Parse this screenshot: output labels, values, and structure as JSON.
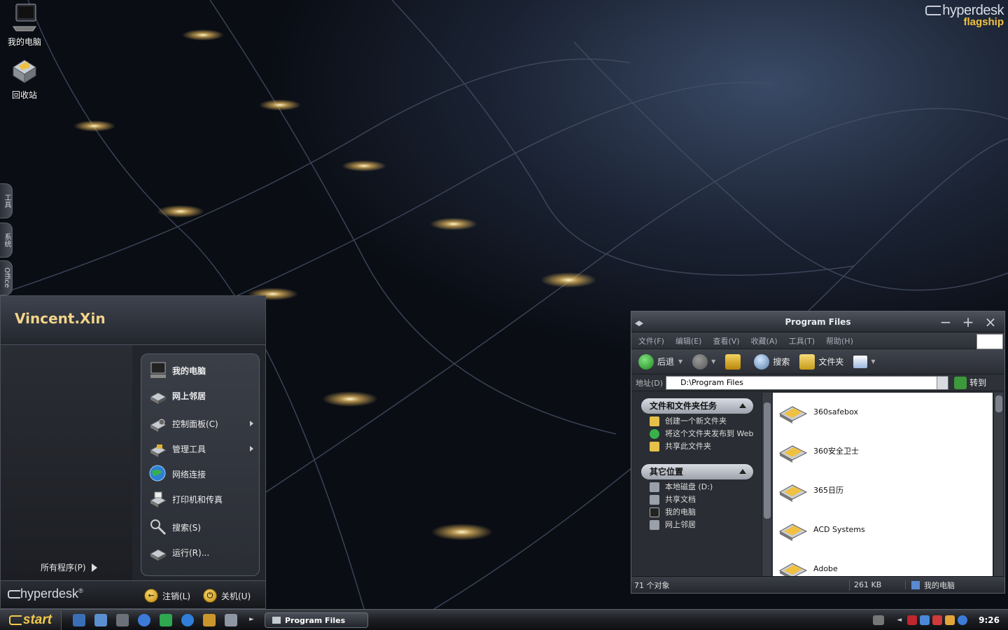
{
  "brand": {
    "name": "hyperdesk",
    "edition": "flagship"
  },
  "desktop_icons": [
    {
      "label": "我的电脑",
      "icon": "computer-icon"
    },
    {
      "label": "回收站",
      "icon": "recycle-bin-icon"
    }
  ],
  "side_tabs": [
    "工具",
    "系统",
    "Office"
  ],
  "start_menu": {
    "user": "Vincent.Xin",
    "all_programs": "所有程序(P)",
    "items": [
      {
        "label": "我的电脑",
        "icon": "computer-icon"
      },
      {
        "label": "网上邻居",
        "icon": "network-icon"
      },
      {
        "label": "控制面板(C)",
        "icon": "control-panel-icon"
      },
      {
        "label": "管理工具",
        "icon": "admin-tools-icon"
      },
      {
        "label": "网络连接",
        "icon": "network-connections-icon"
      },
      {
        "label": "打印机和传真",
        "icon": "printer-icon"
      },
      {
        "label": "搜索(S)",
        "icon": "search-icon"
      },
      {
        "label": "运行(R)...",
        "icon": "run-icon"
      }
    ],
    "footer": {
      "logo": "hyperdesk",
      "logoff": "注销(L)",
      "shutdown": "关机(U)"
    }
  },
  "taskbar": {
    "start": "start",
    "window_button": "Program Files",
    "clock": "9:26"
  },
  "explorer": {
    "title": "Program Files",
    "menu": [
      "文件(F)",
      "编辑(E)",
      "查看(V)",
      "收藏(A)",
      "工具(T)",
      "帮助(H)"
    ],
    "toolbar": {
      "back": "后退",
      "search": "搜索",
      "folders": "文件夹"
    },
    "address": {
      "label": "地址(D)",
      "value": "D:\\Program Files",
      "go": "转到"
    },
    "tasks": {
      "header": "文件和文件夹任务",
      "links": [
        "创建一个新文件夹",
        "将这个文件夹发布到 Web",
        "共享此文件夹"
      ]
    },
    "places": {
      "header": "其它位置",
      "links": [
        "本地磁盘 (D:)",
        "共享文档",
        "我的电脑",
        "网上邻居"
      ]
    },
    "files": [
      "360safebox",
      "360安全卫士",
      "365日历",
      "ACD Systems",
      "Adobe"
    ],
    "status": {
      "count": "71 个对象",
      "size": "261 KB",
      "location": "我的电脑"
    }
  }
}
